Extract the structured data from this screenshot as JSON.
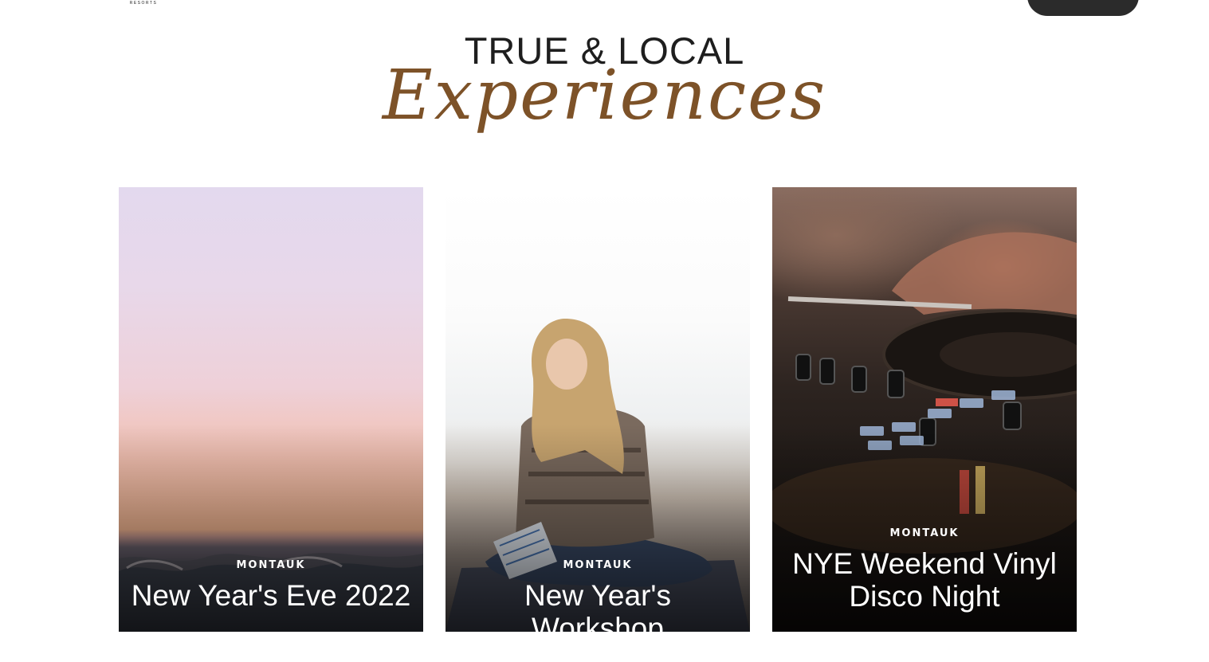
{
  "header": {
    "logo_sub": "RESORTS"
  },
  "headline": {
    "top": "TRUE & LOCAL",
    "script": "Experiences"
  },
  "cards": [
    {
      "location": "MONTAUK",
      "title": "New Year's Eve 2022"
    },
    {
      "location": "MONTAUK",
      "title": "New Year's Workshop"
    },
    {
      "location": "MONTAUK",
      "title": "NYE Weekend Vinyl Disco Night"
    }
  ],
  "colors": {
    "script_accent": "#7d5228",
    "cta_background": "#2b2b2b"
  }
}
